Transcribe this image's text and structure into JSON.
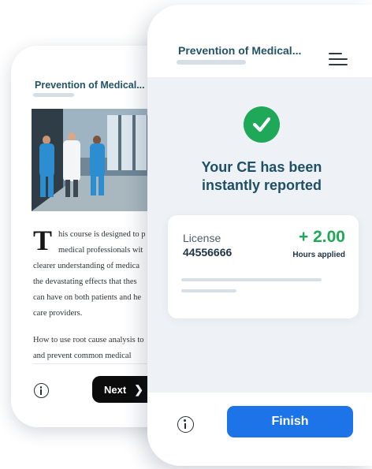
{
  "back_screen": {
    "header_title": "Prevention of Medical...",
    "article": {
      "dropcap": "T",
      "lines": [
        "his course is designed to p",
        "medical professionals wit",
        "clearer understanding of medica",
        "the devastating effects that thes",
        "can have on both patients and he",
        "care providers."
      ],
      "paragraph2": [
        "How to use root cause analysis to",
        "and prevent common medical"
      ]
    },
    "next_label": "Next",
    "next_icon": "chevron-right-icon",
    "info_icon": "info-icon"
  },
  "front_screen": {
    "header_title": "Prevention of Medical...",
    "menu_icon": "hamburger-menu-icon",
    "success_icon": "check-circle-icon",
    "success_message_line1": "Your CE has been",
    "success_message_line2": "instantly reported",
    "license_label": "License",
    "license_number": "44556666",
    "hours_value": "+ 2.00",
    "hours_label": "Hours applied",
    "finish_label": "Finish",
    "info_icon": "info-icon"
  },
  "colors": {
    "title": "#235466",
    "success_green": "#1ea857",
    "primary_blue": "#1c74e8",
    "body_bg": "#eef2f6"
  }
}
